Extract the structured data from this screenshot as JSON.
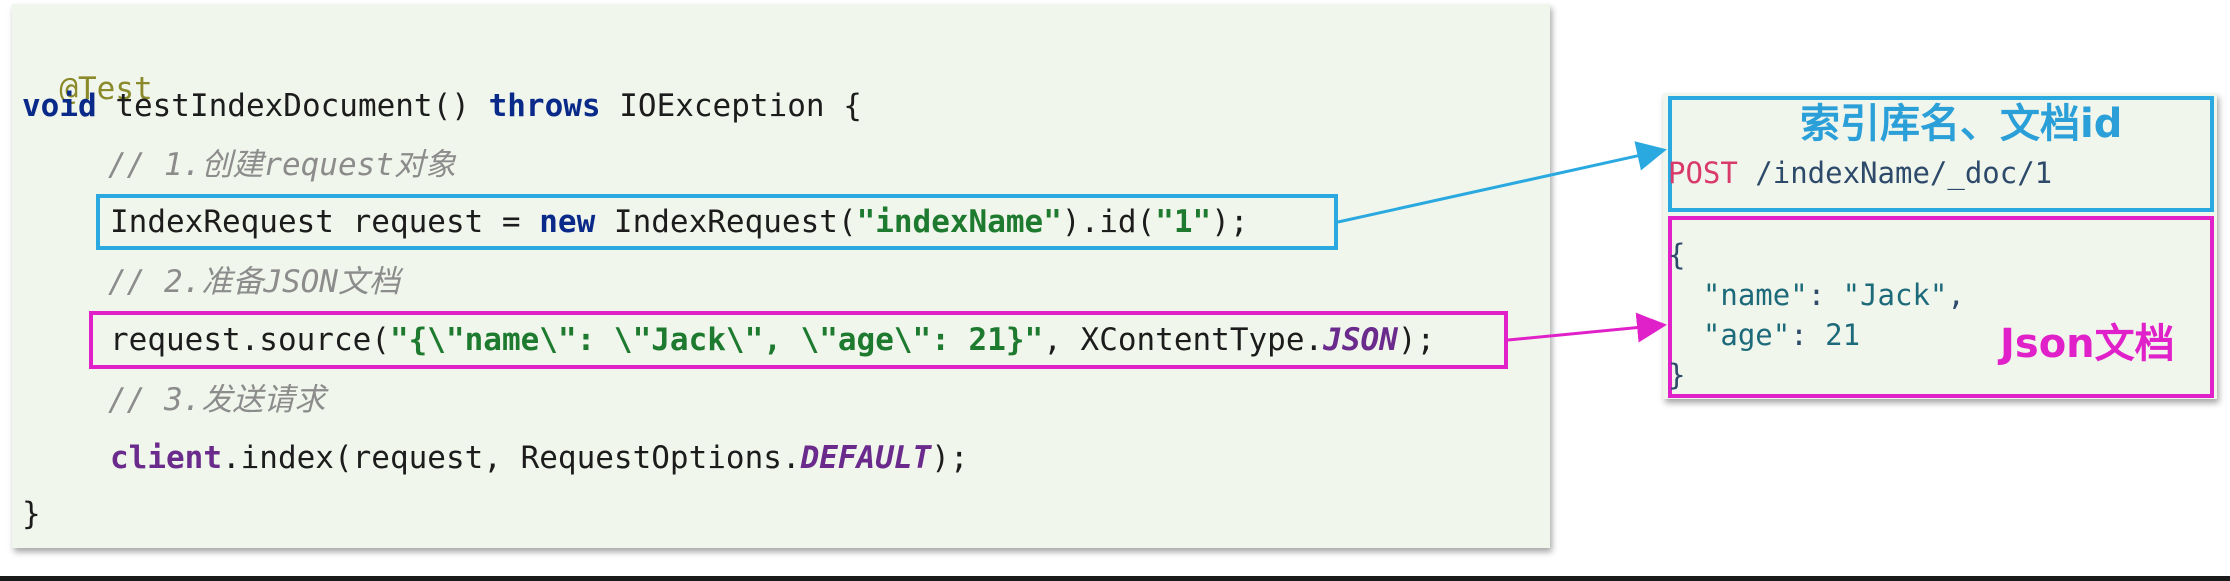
{
  "code": {
    "annotation": "@Test",
    "sig_void": "void",
    "sig_name": " testIndexDocument() ",
    "sig_throws": "throws",
    "sig_rest": " IOException {",
    "comment1": "// 1.创建request对象",
    "l4_a": "IndexRequest request = ",
    "l4_new": "new",
    "l4_b": " IndexRequest(",
    "l4_str1": "\"indexName\"",
    "l4_c": ").id(",
    "l4_str2": "\"1\"",
    "l4_d": ");",
    "comment2": "// 2.准备JSON文档",
    "l6_a": "request.source(",
    "l6_str": "\"{\\\"name\\\": \\\"Jack\\\", \\\"age\\\": 21}\"",
    "l6_b": ", XContentType.",
    "l6_field": "JSON",
    "l6_c": ");",
    "comment3": "// 3.发送请求",
    "l8_var": "client",
    "l8_a": ".index(request, RequestOptions.",
    "l8_field": "DEFAULT",
    "l8_b": ");",
    "close": "}"
  },
  "request": {
    "label_top": "索引库名、文档id",
    "method": "POST",
    "path": " /indexName/_doc/1",
    "json_open": "{",
    "json_name_key": "\"name\"",
    "json_name_sep": ": ",
    "json_name_val": "\"Jack\"",
    "json_name_end": ",",
    "json_age_key": "\"age\"",
    "json_age_sep": ": ",
    "json_age_val": "21",
    "json_close": "}",
    "label_json": "Json文档"
  },
  "colors": {
    "highlight_blue": "#2aa9e0",
    "highlight_pink": "#e020c8",
    "panel_bg": "#f1f6ec"
  }
}
